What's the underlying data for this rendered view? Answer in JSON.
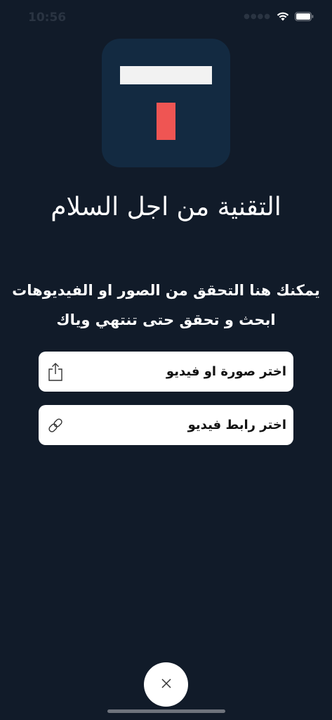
{
  "status_bar": {
    "time": "10:56"
  },
  "header": {
    "title": "التقنية من اجل السلام"
  },
  "description": {
    "line1": "يمكنك هنا التحقق من الصور او الفيديوهات",
    "line2": "ابحث و تحقق حتى تنتهي وياك"
  },
  "options": [
    {
      "label": "اختر صورة او فيديو",
      "icon": "share-upload-icon"
    },
    {
      "label": "اختر رابط فيديو",
      "icon": "link-icon"
    }
  ],
  "close": {
    "icon": "close-icon"
  },
  "colors": {
    "background": "#111b29",
    "logo_bg": "#132a41",
    "logo_bar": "#f2f2f2",
    "logo_accent": "#ef5553",
    "card_bg": "#ffffff"
  }
}
